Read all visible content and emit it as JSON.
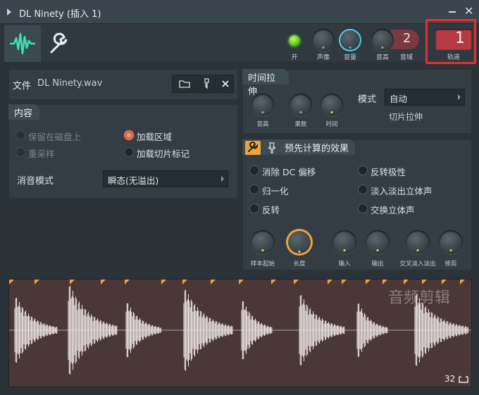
{
  "window": {
    "title": "DL Ninety (插入 1)",
    "close_glyph": "✕"
  },
  "toolbar": {
    "power_label": "开",
    "pan_label": "声像",
    "volume_label": "音量",
    "pitch_label": "音高",
    "range_label": "音域",
    "mixer_track": "2",
    "track_number": "1",
    "track_label": "轨道"
  },
  "file": {
    "label": "文件",
    "name": "DL Ninety.wav"
  },
  "content": {
    "title": "内容",
    "options": [
      {
        "label": "保留在磁盘上",
        "state": "disabled"
      },
      {
        "label": "重采样",
        "state": "disabled"
      },
      {
        "label": "加载区域",
        "state": "on"
      },
      {
        "label": "加载切片标记",
        "state": "off"
      }
    ],
    "declick_label": "消音模式",
    "declick_value": "瞬态(无溢出)"
  },
  "stretch": {
    "title": "时间拉伸",
    "knobs": [
      "音高",
      "乘数",
      "时间"
    ],
    "mode_label": "模式",
    "mode_value": "自动",
    "mode_sub": "切片拉伸"
  },
  "precomputed": {
    "title": "预先计算的效果",
    "options": [
      "消除 DC 偏移",
      "反转极性",
      "归一化",
      "淡入淡出立体声",
      "反转",
      "交换立体声"
    ],
    "knobs": [
      "样本起始",
      "长度",
      "输入",
      "输出",
      "交叉淡入淡出",
      "修剪"
    ]
  },
  "waveform": {
    "watermark": "音频剪辑",
    "zoom_value": "32",
    "marker_color": "#f0a23a",
    "wave_color": "#f2eaea"
  },
  "colors": {
    "accent_green": "#3fe0b0",
    "accent_orange": "#f0a23a",
    "track_red": "#b53a42",
    "highlight_red": "#e53030"
  },
  "icons": [
    "chevron-right-icon",
    "minimize-icon",
    "close-icon",
    "waveform-icon",
    "wrench-icon",
    "folder-icon",
    "key-icon",
    "x-icon",
    "pin-icon",
    "resize-icon"
  ]
}
